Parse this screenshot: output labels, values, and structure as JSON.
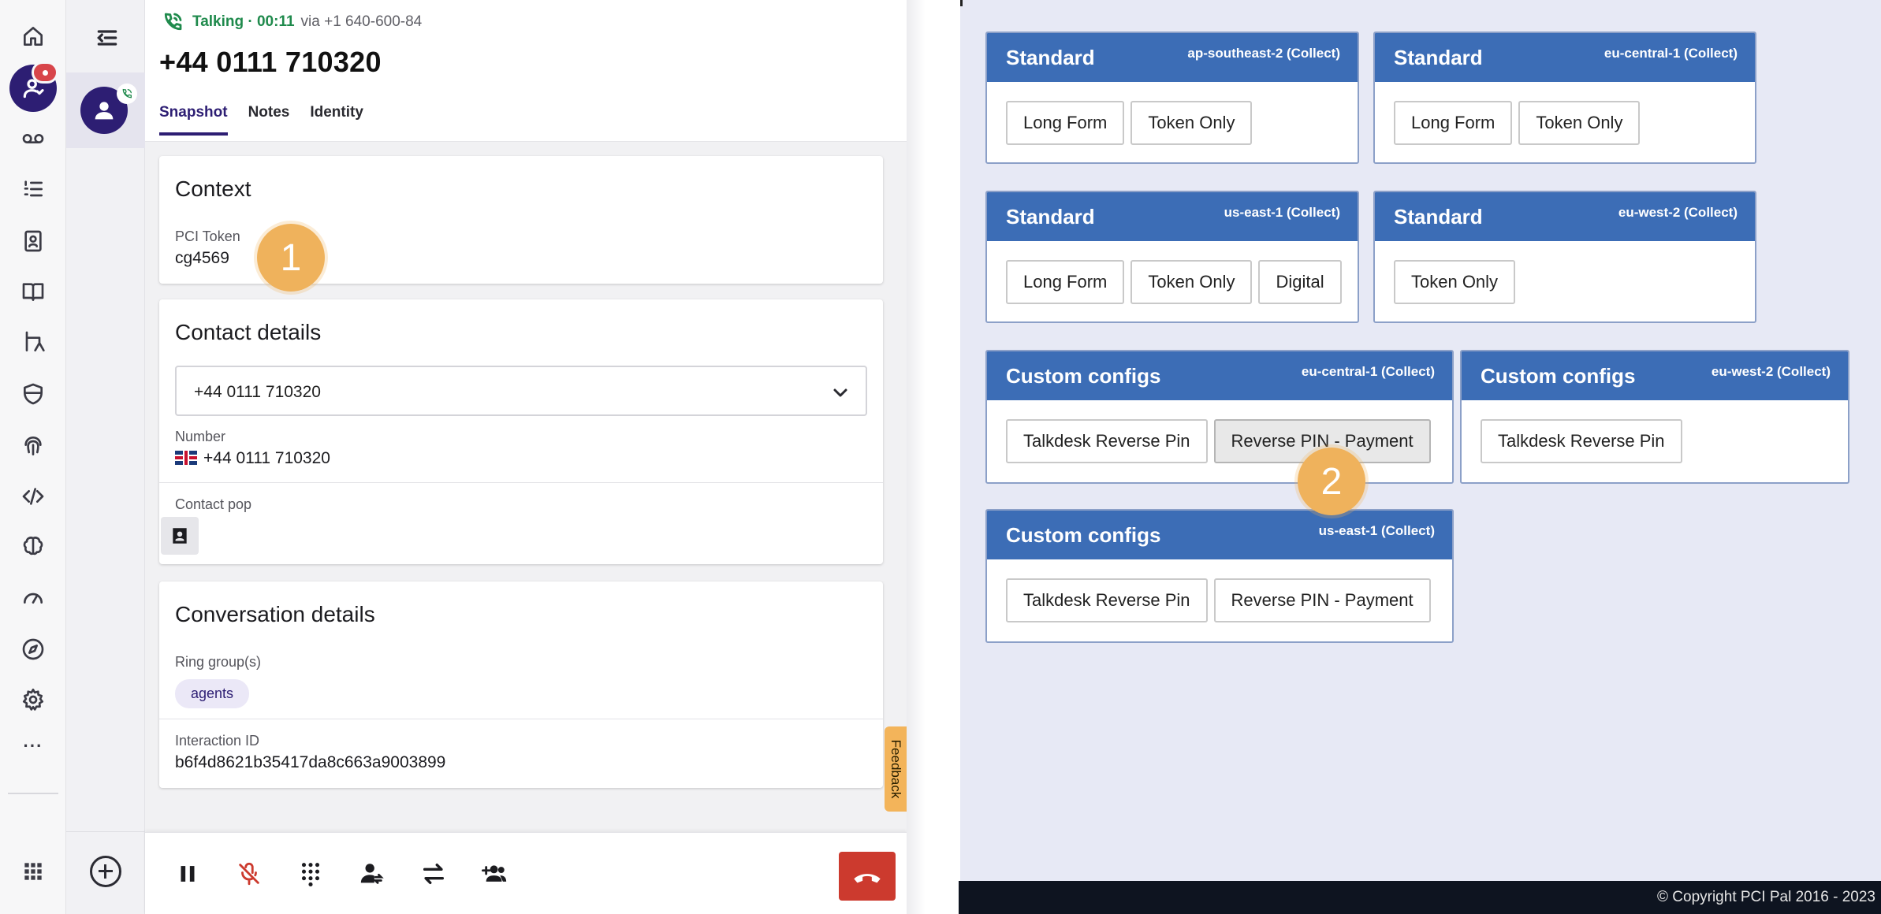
{
  "call": {
    "status": "Talking · 00:11",
    "via": "via +1 640-600-84",
    "number": "+44 0111 710320"
  },
  "tabs": [
    {
      "label": "Snapshot",
      "active": true
    },
    {
      "label": "Notes",
      "active": false
    },
    {
      "label": "Identity",
      "active": false
    }
  ],
  "context": {
    "title": "Context",
    "pci_token_label": "PCI Token",
    "pci_token_value": "cg4569"
  },
  "contact_details": {
    "title": "Contact details",
    "selected_number": "+44 0111 710320",
    "number_label": "Number",
    "number_value": "+44 0111 710320",
    "contact_pop_label": "Contact pop"
  },
  "conversation_details": {
    "title": "Conversation details",
    "ring_groups_label": "Ring group(s)",
    "ring_group_chip": "agents",
    "interaction_id_label": "Interaction ID",
    "interaction_id_value": "b6f4d8621b35417da8c663a9003899"
  },
  "feedback_label": "Feedback",
  "steps": {
    "one": "1",
    "two": "2"
  },
  "rail": {
    "more": "···"
  },
  "pcipal": {
    "configs": [
      {
        "title": "Standard",
        "region": "ap-southeast-2 (Collect)",
        "buttons": [
          "Long Form",
          "Token Only"
        ]
      },
      {
        "title": "Standard",
        "region": "eu-central-1 (Collect)",
        "buttons": [
          "Long Form",
          "Token Only"
        ]
      },
      {
        "title": "Standard",
        "region": "us-east-1 (Collect)",
        "buttons": [
          "Long Form",
          "Token Only",
          "Digital"
        ]
      },
      {
        "title": "Standard",
        "region": "eu-west-2 (Collect)",
        "buttons": [
          "Token Only"
        ]
      },
      {
        "title": "Custom configs",
        "region": "eu-central-1 (Collect)",
        "buttons": [
          "Talkdesk Reverse Pin",
          "Reverse PIN - Payment"
        ]
      },
      {
        "title": "Custom configs",
        "region": "eu-west-2 (Collect)",
        "buttons": [
          "Talkdesk Reverse Pin"
        ]
      },
      {
        "title": "Custom configs",
        "region": "us-east-1 (Collect)",
        "buttons": [
          "Talkdesk Reverse Pin",
          "Reverse PIN - Payment"
        ]
      }
    ],
    "copyright": "© Copyright PCI Pal 2016 - 2023"
  },
  "colors": {
    "brand_purple": "#2d1e73",
    "talking_green": "#1f8a4c",
    "hangup_red": "#cc3a2e",
    "pci_header_blue": "#3c6db6",
    "step_badge": "#efb25c"
  }
}
